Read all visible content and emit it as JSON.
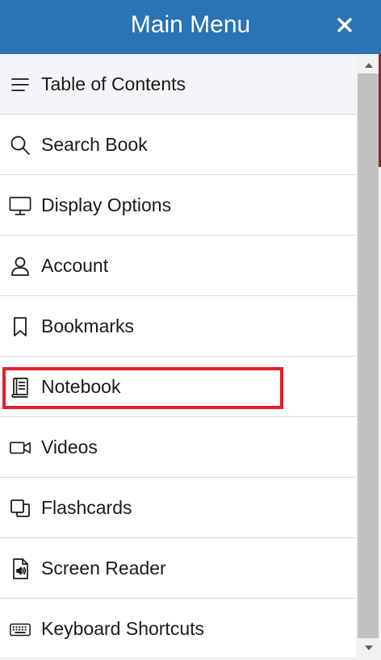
{
  "header": {
    "title": "Main Menu",
    "close_icon": "close-icon",
    "background_color": "#2a73b4"
  },
  "menu": {
    "items": [
      {
        "label": "Table of Contents",
        "icon": "list-icon",
        "active": true
      },
      {
        "label": "Search Book",
        "icon": "search-icon"
      },
      {
        "label": "Display Options",
        "icon": "monitor-icon"
      },
      {
        "label": "Account",
        "icon": "user-icon"
      },
      {
        "label": "Bookmarks",
        "icon": "bookmark-icon"
      },
      {
        "label": "Notebook",
        "icon": "notebook-icon",
        "highlighted": true
      },
      {
        "label": "Videos",
        "icon": "video-camera-icon"
      },
      {
        "label": "Flashcards",
        "icon": "flashcards-icon"
      },
      {
        "label": "Screen Reader",
        "icon": "screen-reader-icon"
      },
      {
        "label": "Keyboard Shortcuts",
        "icon": "keyboard-icon"
      }
    ]
  },
  "colors": {
    "highlight_border": "#e0202b",
    "active_item_background": "#f3f5f8"
  }
}
